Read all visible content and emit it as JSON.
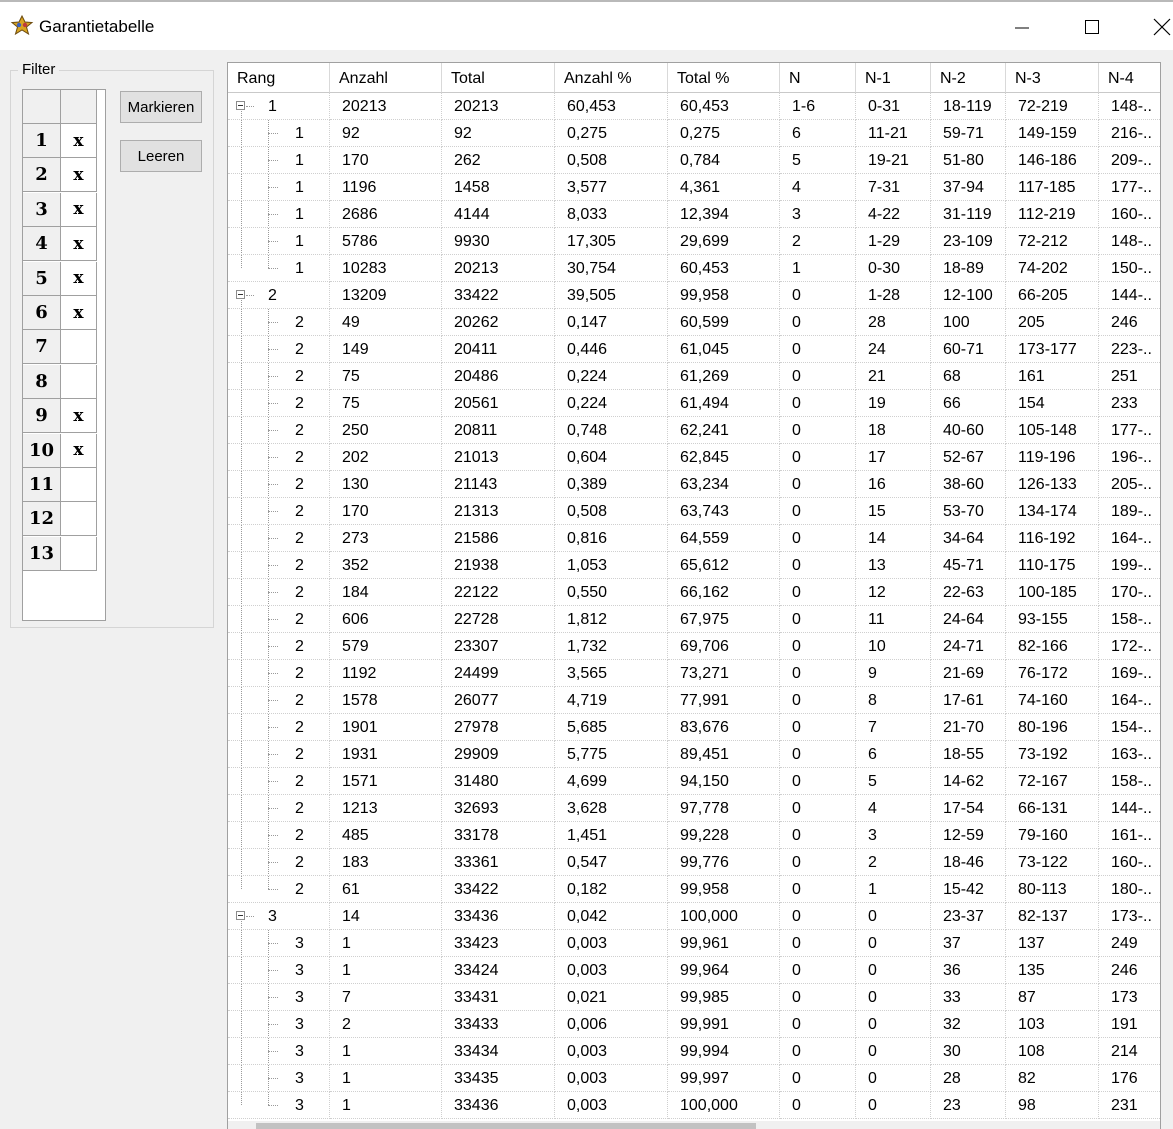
{
  "window": {
    "title": "Garantietabelle"
  },
  "filter": {
    "legend": "Filter",
    "rows": [
      {
        "num": "1",
        "mark": "x"
      },
      {
        "num": "2",
        "mark": "x"
      },
      {
        "num": "3",
        "mark": "x"
      },
      {
        "num": "4",
        "mark": "x"
      },
      {
        "num": "5",
        "mark": "x"
      },
      {
        "num": "6",
        "mark": "x"
      },
      {
        "num": "7",
        "mark": ""
      },
      {
        "num": "8",
        "mark": ""
      },
      {
        "num": "9",
        "mark": "x"
      },
      {
        "num": "10",
        "mark": "x"
      },
      {
        "num": "11",
        "mark": ""
      },
      {
        "num": "12",
        "mark": ""
      },
      {
        "num": "13",
        "mark": ""
      }
    ],
    "mark_button": "Markieren",
    "clear_button": "Leeren"
  },
  "grid": {
    "columns": [
      "Rang",
      "Anzahl",
      "Total",
      "Anzahl %",
      "Total %",
      "N",
      "N-1",
      "N-2",
      "N-3",
      "N-4"
    ],
    "rows": [
      {
        "level": 0,
        "rang": "1",
        "cells": [
          "20213",
          "20213",
          "60,453",
          "60,453",
          "1-6",
          "0-31",
          "18-119",
          "72-219",
          "148-.."
        ]
      },
      {
        "level": 1,
        "rang": "1",
        "cells": [
          "92",
          "92",
          "0,275",
          "0,275",
          "6",
          "11-21",
          "59-71",
          "149-159",
          "216-.."
        ]
      },
      {
        "level": 1,
        "rang": "1",
        "cells": [
          "170",
          "262",
          "0,508",
          "0,784",
          "5",
          "19-21",
          "51-80",
          "146-186",
          "209-.."
        ]
      },
      {
        "level": 1,
        "rang": "1",
        "cells": [
          "1196",
          "1458",
          "3,577",
          "4,361",
          "4",
          "7-31",
          "37-94",
          "117-185",
          "177-.."
        ]
      },
      {
        "level": 1,
        "rang": "1",
        "cells": [
          "2686",
          "4144",
          "8,033",
          "12,394",
          "3",
          "4-22",
          "31-119",
          "112-219",
          "160-.."
        ]
      },
      {
        "level": 1,
        "rang": "1",
        "cells": [
          "5786",
          "9930",
          "17,305",
          "29,699",
          "2",
          "1-29",
          "23-109",
          "72-212",
          "148-.."
        ]
      },
      {
        "level": 1,
        "rang": "1",
        "cells": [
          "10283",
          "20213",
          "30,754",
          "60,453",
          "1",
          "0-30",
          "18-89",
          "74-202",
          "150-.."
        ],
        "last": true
      },
      {
        "level": 0,
        "rang": "2",
        "cells": [
          "13209",
          "33422",
          "39,505",
          "99,958",
          "0",
          "1-28",
          "12-100",
          "66-205",
          "144-.."
        ]
      },
      {
        "level": 1,
        "rang": "2",
        "cells": [
          "49",
          "20262",
          "0,147",
          "60,599",
          "0",
          "28",
          "100",
          "205",
          "246"
        ]
      },
      {
        "level": 1,
        "rang": "2",
        "cells": [
          "149",
          "20411",
          "0,446",
          "61,045",
          "0",
          "24",
          "60-71",
          "173-177",
          "223-.."
        ]
      },
      {
        "level": 1,
        "rang": "2",
        "cells": [
          "75",
          "20486",
          "0,224",
          "61,269",
          "0",
          "21",
          "68",
          "161",
          "251"
        ]
      },
      {
        "level": 1,
        "rang": "2",
        "cells": [
          "75",
          "20561",
          "0,224",
          "61,494",
          "0",
          "19",
          "66",
          "154",
          "233"
        ]
      },
      {
        "level": 1,
        "rang": "2",
        "cells": [
          "250",
          "20811",
          "0,748",
          "62,241",
          "0",
          "18",
          "40-60",
          "105-148",
          "177-.."
        ]
      },
      {
        "level": 1,
        "rang": "2",
        "cells": [
          "202",
          "21013",
          "0,604",
          "62,845",
          "0",
          "17",
          "52-67",
          "119-196",
          "196-.."
        ]
      },
      {
        "level": 1,
        "rang": "2",
        "cells": [
          "130",
          "21143",
          "0,389",
          "63,234",
          "0",
          "16",
          "38-60",
          "126-133",
          "205-.."
        ]
      },
      {
        "level": 1,
        "rang": "2",
        "cells": [
          "170",
          "21313",
          "0,508",
          "63,743",
          "0",
          "15",
          "53-70",
          "134-174",
          "189-.."
        ]
      },
      {
        "level": 1,
        "rang": "2",
        "cells": [
          "273",
          "21586",
          "0,816",
          "64,559",
          "0",
          "14",
          "34-64",
          "116-192",
          "164-.."
        ]
      },
      {
        "level": 1,
        "rang": "2",
        "cells": [
          "352",
          "21938",
          "1,053",
          "65,612",
          "0",
          "13",
          "45-71",
          "110-175",
          "199-.."
        ]
      },
      {
        "level": 1,
        "rang": "2",
        "cells": [
          "184",
          "22122",
          "0,550",
          "66,162",
          "0",
          "12",
          "22-63",
          "100-185",
          "170-.."
        ]
      },
      {
        "level": 1,
        "rang": "2",
        "cells": [
          "606",
          "22728",
          "1,812",
          "67,975",
          "0",
          "11",
          "24-64",
          "93-155",
          "158-.."
        ]
      },
      {
        "level": 1,
        "rang": "2",
        "cells": [
          "579",
          "23307",
          "1,732",
          "69,706",
          "0",
          "10",
          "24-71",
          "82-166",
          "172-.."
        ]
      },
      {
        "level": 1,
        "rang": "2",
        "cells": [
          "1192",
          "24499",
          "3,565",
          "73,271",
          "0",
          "9",
          "21-69",
          "76-172",
          "169-.."
        ]
      },
      {
        "level": 1,
        "rang": "2",
        "cells": [
          "1578",
          "26077",
          "4,719",
          "77,991",
          "0",
          "8",
          "17-61",
          "74-160",
          "164-.."
        ]
      },
      {
        "level": 1,
        "rang": "2",
        "cells": [
          "1901",
          "27978",
          "5,685",
          "83,676",
          "0",
          "7",
          "21-70",
          "80-196",
          "154-.."
        ]
      },
      {
        "level": 1,
        "rang": "2",
        "cells": [
          "1931",
          "29909",
          "5,775",
          "89,451",
          "0",
          "6",
          "18-55",
          "73-192",
          "163-.."
        ]
      },
      {
        "level": 1,
        "rang": "2",
        "cells": [
          "1571",
          "31480",
          "4,699",
          "94,150",
          "0",
          "5",
          "14-62",
          "72-167",
          "158-.."
        ]
      },
      {
        "level": 1,
        "rang": "2",
        "cells": [
          "1213",
          "32693",
          "3,628",
          "97,778",
          "0",
          "4",
          "17-54",
          "66-131",
          "144-.."
        ]
      },
      {
        "level": 1,
        "rang": "2",
        "cells": [
          "485",
          "33178",
          "1,451",
          "99,228",
          "0",
          "3",
          "12-59",
          "79-160",
          "161-.."
        ]
      },
      {
        "level": 1,
        "rang": "2",
        "cells": [
          "183",
          "33361",
          "0,547",
          "99,776",
          "0",
          "2",
          "18-46",
          "73-122",
          "160-.."
        ]
      },
      {
        "level": 1,
        "rang": "2",
        "cells": [
          "61",
          "33422",
          "0,182",
          "99,958",
          "0",
          "1",
          "15-42",
          "80-113",
          "180-.."
        ],
        "last": true
      },
      {
        "level": 0,
        "rang": "3",
        "cells": [
          "14",
          "33436",
          "0,042",
          "100,000",
          "0",
          "0",
          "23-37",
          "82-137",
          "173-.."
        ]
      },
      {
        "level": 1,
        "rang": "3",
        "cells": [
          "1",
          "33423",
          "0,003",
          "99,961",
          "0",
          "0",
          "37",
          "137",
          "249"
        ]
      },
      {
        "level": 1,
        "rang": "3",
        "cells": [
          "1",
          "33424",
          "0,003",
          "99,964",
          "0",
          "0",
          "36",
          "135",
          "246"
        ]
      },
      {
        "level": 1,
        "rang": "3",
        "cells": [
          "7",
          "33431",
          "0,021",
          "99,985",
          "0",
          "0",
          "33",
          "87",
          "173"
        ]
      },
      {
        "level": 1,
        "rang": "3",
        "cells": [
          "2",
          "33433",
          "0,006",
          "99,991",
          "0",
          "0",
          "32",
          "103",
          "191"
        ]
      },
      {
        "level": 1,
        "rang": "3",
        "cells": [
          "1",
          "33434",
          "0,003",
          "99,994",
          "0",
          "0",
          "30",
          "108",
          "214"
        ]
      },
      {
        "level": 1,
        "rang": "3",
        "cells": [
          "1",
          "33435",
          "0,003",
          "99,997",
          "0",
          "0",
          "28",
          "82",
          "176"
        ]
      },
      {
        "level": 1,
        "rang": "3",
        "cells": [
          "1",
          "33436",
          "0,003",
          "100,000",
          "0",
          "0",
          "23",
          "98",
          "231"
        ],
        "last": true
      }
    ]
  }
}
